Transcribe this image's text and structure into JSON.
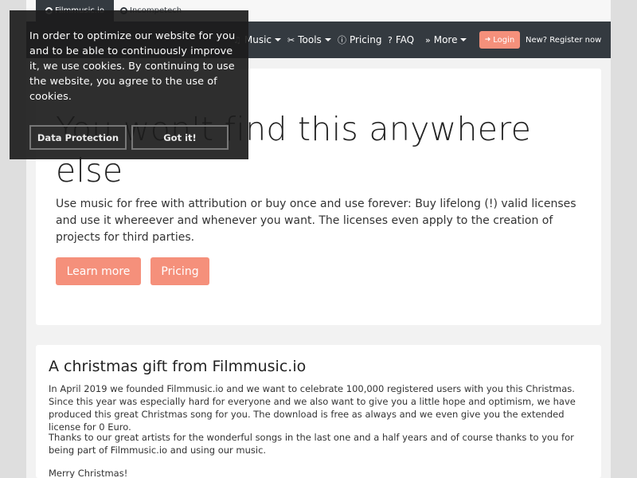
{
  "topbar": {
    "tabs": [
      {
        "label": "Filmmusic.io",
        "icon": "globe-icon"
      },
      {
        "label": "Incompetech",
        "icon": "globe-icon"
      }
    ]
  },
  "navbar": {
    "items": [
      {
        "label": "Music",
        "icon": "music-note-icon",
        "glyph": "♫"
      },
      {
        "label": "Tools",
        "icon": "tools-icon",
        "glyph": "✂"
      },
      {
        "label": "Pricing",
        "icon": "info-icon",
        "glyph": "ⓘ"
      },
      {
        "label": "FAQ",
        "icon": "question-icon",
        "glyph": "?"
      },
      {
        "label": "More",
        "icon": "double-chevron-icon",
        "glyph": "»"
      }
    ],
    "login": {
      "label": "Login",
      "icon": "sign-in-icon",
      "glyph": "➜"
    },
    "register": "New? Register now"
  },
  "hero": {
    "title": "You won't find this anywhere else",
    "text": "Use music for free with attribution or buy once and use forever: Buy lifelong (!) valid licenses and use it whereever and whenever you want. The licenses even apply to the creation of projects for third parties.",
    "buttons": {
      "learn_more": "Learn more",
      "pricing": "Pricing"
    }
  },
  "news": {
    "title": "A christmas gift from Filmmusic.io",
    "paragraphs": [
      "In April 2019 we founded Filmmusic.io and we want to celebrate 100,000 registered users with you this Christmas. Since this year was especially hard for everyone and we also want to give you a little hope and optimism, we have produced this great Christmas song for you. The download is free as always and we even give you the extended license for 0 Euro.",
      "Thanks to our great artists for the wonderful songs in the last one and a half years and of course thanks to you for being part of Filmmusic.io and using our music.",
      "Merry Christmas!"
    ]
  },
  "cookie": {
    "message": "In order to optimize our website for you and to be able to continuously improve it, we use cookies. By continuing to use the website, you agree to the use of cookies.",
    "data_protection": "Data Protection",
    "got_it": "Got it!"
  },
  "colors": {
    "navbar": "#343a40",
    "accent": "#f5907b",
    "page_bg": "#f2f2f2"
  }
}
